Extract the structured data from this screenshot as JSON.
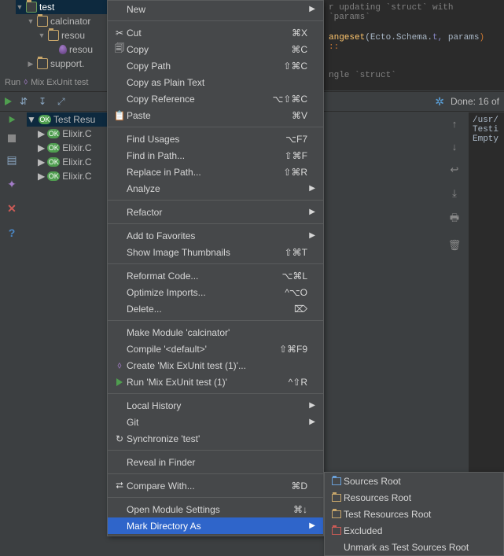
{
  "tree": {
    "test": "test",
    "calcinator": "calcinator",
    "resou1": "resou",
    "resou2": "resou",
    "support": "support."
  },
  "runline": "Mix ExUnit test",
  "runline_prefix": "Run",
  "toolbar": {
    "done": "Done: 16 of"
  },
  "results": {
    "header": "Test Resu",
    "rows": [
      "Elixir.C",
      "Elixir.C",
      "Elixir.C",
      "Elixir.C"
    ]
  },
  "editor": {
    "l1a": "r updating ",
    "l1b": "`struct`",
    "l1c": " with ",
    "l1d": "`params`",
    "l2a": "angeset",
    "l2b": "(Ecto.Schema.",
    "l2c": "t, ",
    "l2d": "params",
    "l2e": ") ::",
    "l3": "ngle `struct`"
  },
  "output": {
    "l1": "/usr/",
    "l2": "Testi",
    "l3": "Empty"
  },
  "menu": {
    "new": "New",
    "cut": "Cut",
    "cut_sc": "⌘X",
    "copy": "Copy",
    "copy_sc": "⌘C",
    "copy_path": "Copy Path",
    "copy_path_sc": "⇧⌘C",
    "copy_plain": "Copy as Plain Text",
    "copy_ref": "Copy Reference",
    "copy_ref_sc": "⌥⇧⌘C",
    "paste": "Paste",
    "paste_sc": "⌘V",
    "find_usages": "Find Usages",
    "find_usages_sc": "⌥F7",
    "find_in_path": "Find in Path...",
    "find_in_path_sc": "⇧⌘F",
    "replace_in_path": "Replace in Path...",
    "replace_in_path_sc": "⇧⌘R",
    "analyze": "Analyze",
    "refactor": "Refactor",
    "add_fav": "Add to Favorites",
    "thumbs": "Show Image Thumbnails",
    "thumbs_sc": "⇧⌘T",
    "reformat": "Reformat Code...",
    "reformat_sc": "⌥⌘L",
    "optimize": "Optimize Imports...",
    "optimize_sc": "^⌥O",
    "delete": "Delete...",
    "delete_sc": "⌦",
    "make_module": "Make Module 'calcinator'",
    "compile": "Compile '<default>'",
    "compile_sc": "⇧⌘F9",
    "create_mix": "Create 'Mix ExUnit test (1)'...",
    "run_mix": "Run 'Mix ExUnit test (1)'",
    "run_mix_sc": "^⇧R",
    "local_history": "Local History",
    "git": "Git",
    "sync": "Synchronize 'test'",
    "reveal": "Reveal in Finder",
    "compare": "Compare With...",
    "compare_sc": "⌘D",
    "open_module": "Open Module Settings",
    "open_module_sc": "⌘↓",
    "mark_dir": "Mark Directory As"
  },
  "submenu": {
    "sources": "Sources Root",
    "resources": "Resources Root",
    "test_res": "Test Resources Root",
    "excluded": "Excluded",
    "unmark": "Unmark as Test Sources Root"
  }
}
